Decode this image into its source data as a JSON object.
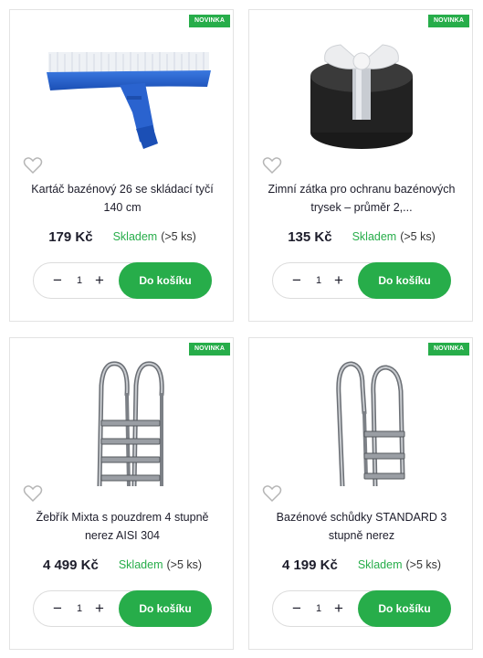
{
  "colors": {
    "accent": "#27ad4a",
    "text": "#1d1d2b",
    "border": "#e3e3e3"
  },
  "products": [
    {
      "badge": "NOVINKA",
      "image_icon": "pool-brush-icon",
      "name": "Kartáč bazénový 26 se skládací tyčí 140 cm",
      "price": "179 Kč",
      "stock": "Skladem",
      "stock_count": "(>5 ks)",
      "qty": "1",
      "cart_label": "Do košíku"
    },
    {
      "badge": "NOVINKA",
      "image_icon": "winter-plug-icon",
      "name": "Zimní zátka pro ochranu bazénových trysek – průměr 2,...",
      "price": "135 Kč",
      "stock": "Skladem",
      "stock_count": "(>5 ks)",
      "qty": "1",
      "cart_label": "Do košíku"
    },
    {
      "badge": "NOVINKA",
      "image_icon": "pool-ladder-4-steps-icon",
      "name": "Žebřík Mixta s pouzdrem 4 stupně nerez AISI 304",
      "price": "4 499 Kč",
      "stock": "Skladem",
      "stock_count": "(>5 ks)",
      "qty": "1",
      "cart_label": "Do košíku"
    },
    {
      "badge": "NOVINKA",
      "image_icon": "pool-ladder-3-steps-icon",
      "name": "Bazénové schůdky STANDARD 3 stupně nerez",
      "price": "4 199 Kč",
      "stock": "Skladem",
      "stock_count": "(>5 ks)",
      "qty": "1",
      "cart_label": "Do košíku"
    }
  ]
}
